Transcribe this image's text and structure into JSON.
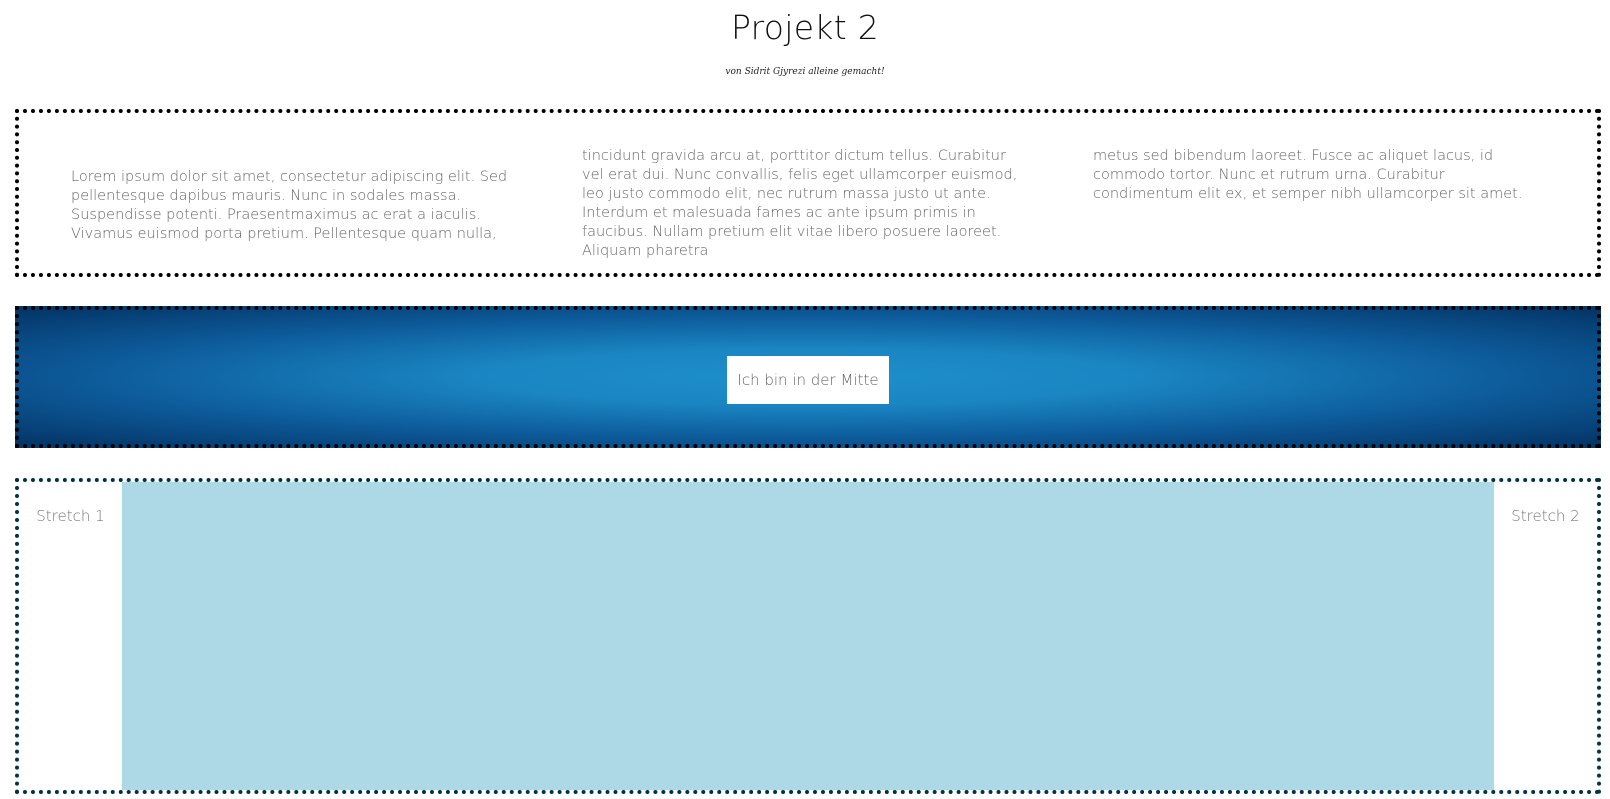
{
  "header": {
    "title": "Projekt 2",
    "subtitle": "von Sidrit Gjyrezi alleine gemacht!"
  },
  "columns": [
    "Lorem ipsum dolor sit amet, consectetur adipiscing elit. Sed pellentesque dapibus mauris. Nunc in sodales massa. Suspendisse potenti. Praesentmaximus ac erat a iaculis. Vivamus euismod porta pretium. Pellentesque quam nulla,",
    "tincidunt gravida arcu at, porttitor dictum tellus. Curabitur vel erat dui. Nunc convallis, felis eget ullamcorper euismod, leo justo commodo elit, nec rutrum massa justo ut ante. Interdum et malesuada fames ac ante ipsum primis in faucibus. Nullam pretium elit vitae libero posuere laoreet. Aliquam pharetra",
    "metus sed bibendum laoreet. Fusce ac aliquet lacus, id commodo tortor. Nunc et rutrum urna. Curabitur condimentum elit ex, et semper nibh ullamcorper sit amet."
  ],
  "center": {
    "label": "Ich bin in der Mitte"
  },
  "stretch": {
    "left_label": "Stretch 1",
    "right_label": "Stretch 2"
  },
  "colors": {
    "gradient_center": "#1e90cc",
    "gradient_edge": "#043567",
    "stretch_fill": "#add8e6",
    "border": "#000000"
  }
}
